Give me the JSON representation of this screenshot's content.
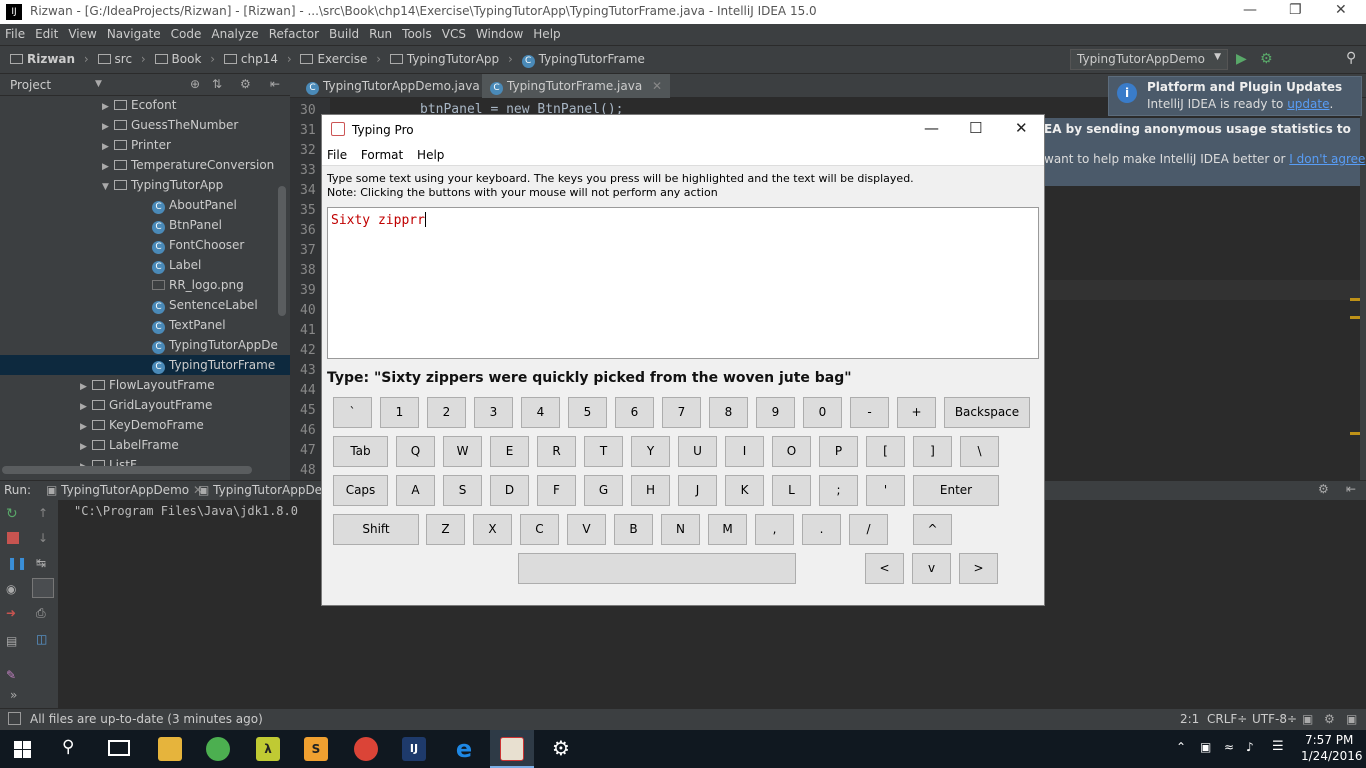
{
  "window": {
    "title": "Rizwan - [G:/IdeaProjects/Rizwan] - [Rizwan] - ...\\src\\Book\\chp14\\Exercise\\TypingTutorApp\\TypingTutorFrame.java - IntelliJ IDEA 15.0"
  },
  "menu": [
    "File",
    "Edit",
    "View",
    "Navigate",
    "Code",
    "Analyze",
    "Refactor",
    "Build",
    "Run",
    "Tools",
    "VCS",
    "Window",
    "Help"
  ],
  "breadcrumbs": [
    "Rizwan",
    "src",
    "Book",
    "chp14",
    "Exercise",
    "TypingTutorApp",
    "TypingTutorFrame"
  ],
  "run_config": "TypingTutorAppDemo",
  "project_panel": {
    "title": "Project"
  },
  "tree": [
    {
      "label": "Ecofont",
      "type": "folder",
      "indent": 1,
      "arrow": "right"
    },
    {
      "label": "GuessTheNumber",
      "type": "folder",
      "indent": 1,
      "arrow": "right"
    },
    {
      "label": "Printer",
      "type": "folder",
      "indent": 1,
      "arrow": "right"
    },
    {
      "label": "TemperatureConversion",
      "type": "folder",
      "indent": 1,
      "arrow": "right"
    },
    {
      "label": "TypingTutorApp",
      "type": "folder",
      "indent": 1,
      "arrow": "down"
    },
    {
      "label": "AboutPanel",
      "type": "class",
      "indent": 2
    },
    {
      "label": "BtnPanel",
      "type": "class",
      "indent": 2
    },
    {
      "label": "FontChooser",
      "type": "class",
      "indent": 2
    },
    {
      "label": "Label",
      "type": "class",
      "indent": 2
    },
    {
      "label": "RR_logo.png",
      "type": "file",
      "indent": 2
    },
    {
      "label": "SentenceLabel",
      "type": "class",
      "indent": 2
    },
    {
      "label": "TextPanel",
      "type": "class",
      "indent": 2
    },
    {
      "label": "TypingTutorAppDe",
      "type": "class",
      "indent": 2
    },
    {
      "label": "TypingTutorFrame",
      "type": "class",
      "indent": 2,
      "selected": true
    },
    {
      "label": "FlowLayoutFrame",
      "type": "folder",
      "indent": 0,
      "arrow": "right"
    },
    {
      "label": "GridLayoutFrame",
      "type": "folder",
      "indent": 0,
      "arrow": "right"
    },
    {
      "label": "KeyDemoFrame",
      "type": "folder",
      "indent": 0,
      "arrow": "right"
    },
    {
      "label": "LabelFrame",
      "type": "folder",
      "indent": 0,
      "arrow": "right"
    },
    {
      "label": "ListF...",
      "type": "folder",
      "indent": 0,
      "arrow": "right"
    }
  ],
  "editor_tabs": [
    "TypingTutorAppDemo.java",
    "TypingTutorFrame.java"
  ],
  "line_numbers": [
    "30",
    "31",
    "32",
    "33",
    "34",
    "35",
    "36",
    "37",
    "38",
    "39",
    "40",
    "41",
    "42",
    "43",
    "44",
    "45",
    "46",
    "47",
    "48"
  ],
  "code_line_30": "btnPanel = new BtnPanel();",
  "notification": {
    "title": "Platform and Plugin Updates",
    "body": "IntelliJ IDEA is ready to",
    "link": "update",
    "body_end": "."
  },
  "notification2": {
    "line1": "EA by sending anonymous usage statistics to",
    "line2": "want to help make IntelliJ IDEA better or",
    "link": "I don't agree"
  },
  "run_panel": {
    "label": "Run:",
    "tabs": [
      "TypingTutorAppDemo",
      "TypingTutorAppDe"
    ],
    "console": "\"C:\\Program Files\\Java\\jdk1.8.0"
  },
  "status": {
    "message": "All files are up-to-date (3 minutes ago)",
    "position": "2:1",
    "line_sep": "CRLF÷",
    "encoding": "UTF-8÷"
  },
  "taskbar": {
    "time": "7:57 PM",
    "date": "1/24/2016"
  },
  "dialog": {
    "title": "Typing Pro",
    "menu": [
      "File",
      "Format",
      "Help"
    ],
    "instruction1": "Type some text using your keyboard. The keys you press will be highlighted and the text will be displayed.",
    "instruction2": "Note: Clicking the buttons with your mouse will not perform any action",
    "typed_text": "Sixty zipprr",
    "prompt": "Type: \"Sixty zippers were quickly picked from the woven jute bag\"",
    "keyboard": {
      "row1": [
        "`",
        "1",
        "2",
        "3",
        "4",
        "5",
        "6",
        "7",
        "8",
        "9",
        "0",
        "-",
        "+",
        "Backspace"
      ],
      "row2": [
        "Tab",
        "Q",
        "W",
        "E",
        "R",
        "T",
        "Y",
        "U",
        "I",
        "O",
        "P",
        "[",
        "]",
        "\\"
      ],
      "row3": [
        "Caps",
        "A",
        "S",
        "D",
        "F",
        "G",
        "H",
        "J",
        "K",
        "L",
        ";",
        "'",
        "Enter"
      ],
      "row4": [
        "Shift",
        "Z",
        "X",
        "C",
        "V",
        "B",
        "N",
        "M",
        ",",
        ".",
        "/",
        "^"
      ],
      "row5": [
        "",
        "<",
        "v",
        ">"
      ]
    }
  }
}
